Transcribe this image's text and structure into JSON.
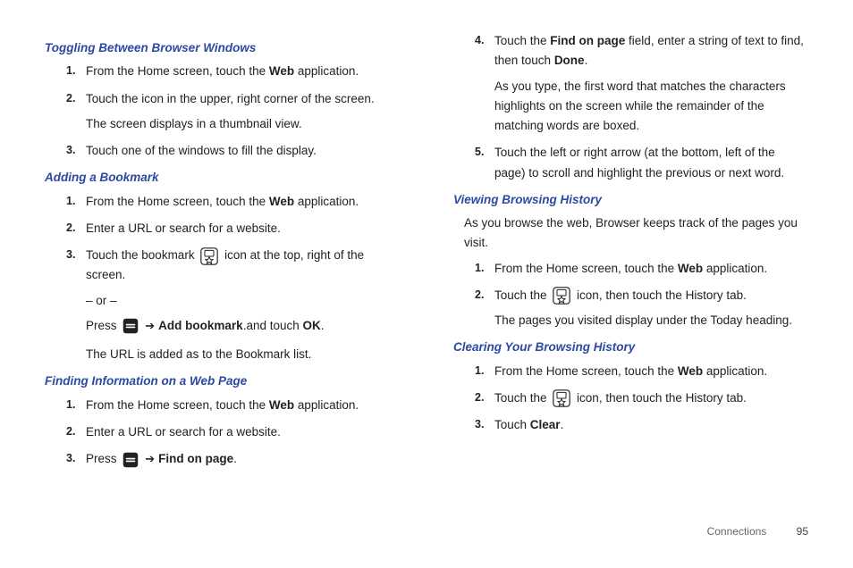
{
  "left": {
    "s1": {
      "title": "Toggling Between Browser Windows",
      "i1a": "From the Home screen, touch the ",
      "i1b": "Web",
      "i1c": " application.",
      "i2a": "Touch the icon in the upper, right corner of the screen.",
      "i2b": "The screen displays in a thumbnail view.",
      "i3": "Touch one of the windows to fill the display."
    },
    "s2": {
      "title": "Adding a Bookmark",
      "i1a": "From the Home screen, touch the ",
      "i1b": "Web",
      "i1c": " application.",
      "i2": "Enter a URL or search for a website.",
      "i3a": "Touch the bookmark ",
      "i3b": " icon at the top, right of the screen.",
      "i3c": "– or –",
      "i3d": "Press ",
      "i3e": "Add bookmark",
      "i3f": ".and touch ",
      "i3g": "OK",
      "i3h": ".",
      "i3i": "The URL is added as to the Bookmark list."
    },
    "s3": {
      "title": "Finding Information on a Web Page",
      "i1a": "From the Home screen, touch the ",
      "i1b": "Web",
      "i1c": " application.",
      "i2": "Enter a URL or search for a website.",
      "i3a": "Press ",
      "i3b": "Find on page",
      "i3c": "."
    }
  },
  "right": {
    "c1": {
      "i4a": "Touch the ",
      "i4b": "Find on page",
      "i4c": " field, enter a string of text to find, then touch ",
      "i4d": "Done",
      "i4e": ".",
      "i4f": "As you type, the first word that matches the characters highlights on the screen while the remainder of the matching words are boxed.",
      "i5": "Touch the left or right arrow (at the bottom, left of the page) to scroll and highlight the previous or next word."
    },
    "s4": {
      "title": "Viewing Browsing History",
      "intro": "As you browse the web, Browser keeps track of the pages you visit.",
      "i1a": "From the Home screen, touch the ",
      "i1b": "Web",
      "i1c": " application.",
      "i2a": "Touch the ",
      "i2b": " icon, then touch the History tab.",
      "i2c": "The pages you visited display under the Today heading."
    },
    "s5": {
      "title": "Clearing Your Browsing History",
      "i1a": "From the Home screen, touch the ",
      "i1b": "Web",
      "i1c": " application.",
      "i2a": "Touch the ",
      "i2b": " icon, then touch the History tab.",
      "i3a": "Touch ",
      "i3b": "Clear",
      "i3c": "."
    }
  },
  "footer": {
    "section": "Connections",
    "page": "95"
  },
  "arrow": "➔"
}
